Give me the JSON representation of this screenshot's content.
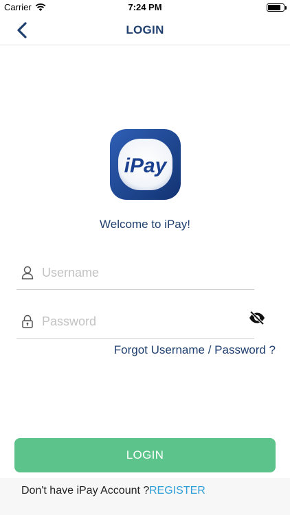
{
  "status_bar": {
    "carrier": "Carrier",
    "time": "7:24 PM",
    "battery_level": 0.8
  },
  "nav": {
    "title": "LOGIN",
    "back_icon": "chevron-left-icon"
  },
  "logo": {
    "text": "iPay",
    "colors": {
      "outer": "#1b3f8f",
      "inner": "#ffffff",
      "text": "#1b3f8f"
    }
  },
  "welcome": "Welcome to iPay!",
  "form": {
    "username": {
      "placeholder": "Username",
      "value": "",
      "icon": "user-icon"
    },
    "password": {
      "placeholder": "Password",
      "value": "",
      "icon": "lock-icon",
      "toggle_icon": "eye-slash-icon"
    }
  },
  "forgot_link": "Forgot Username / Password ?",
  "login_button": "LOGIN",
  "register": {
    "question": "Don't have iPay Account ?",
    "link": "REGISTER"
  },
  "colors": {
    "primary": "#1f3f6e",
    "button": "#5cc48a",
    "link": "#2e9ed8"
  }
}
